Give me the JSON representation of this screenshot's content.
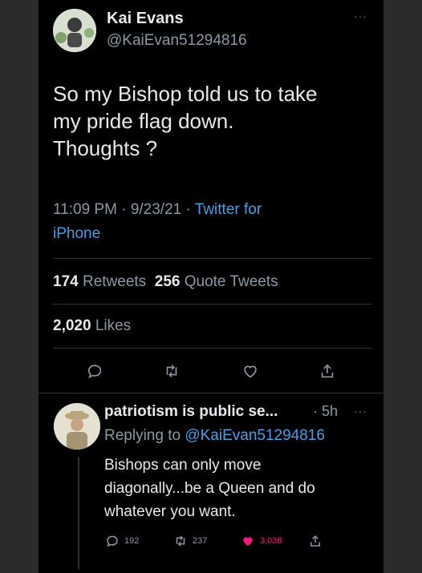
{
  "tweet": {
    "author_name": "Kai Evans",
    "author_handle": "@KaiEvan51294816",
    "text_line1": "So my Bishop told us to take",
    "text_line2": "my pride flag down.",
    "text_line3": "Thoughts ?",
    "time": "11:09 PM",
    "date": "9/23/21",
    "separator": "·",
    "source_line1": "Twitter for",
    "source_line2": "iPhone",
    "retweets_count": "174",
    "retweets_label": "Retweets",
    "quotes_count": "256",
    "quotes_label": "Quote Tweets",
    "likes_count": "2,020",
    "likes_label": "Likes",
    "more_dots": "···"
  },
  "actions": [
    "reply-icon",
    "retweet-icon",
    "like-icon",
    "share-icon"
  ],
  "reply": {
    "author_name": "patriotism is public se...",
    "time": "· 5h",
    "more_dots": "···",
    "replying_prefix": "Replying to",
    "replying_handle": "@KaiEvan51294816",
    "text_line1": "Bishops can only move",
    "text_line2": "diagonally...be a Queen and do",
    "text_line3": "whatever you want.",
    "reply_count": "192",
    "retweet_count": "237",
    "like_count": "3,038"
  },
  "colors": {
    "background": "#000000",
    "text": "#e7e9ea",
    "secondary": "#8b98a5",
    "link": "#4a9fe3",
    "like": "#f91880"
  }
}
